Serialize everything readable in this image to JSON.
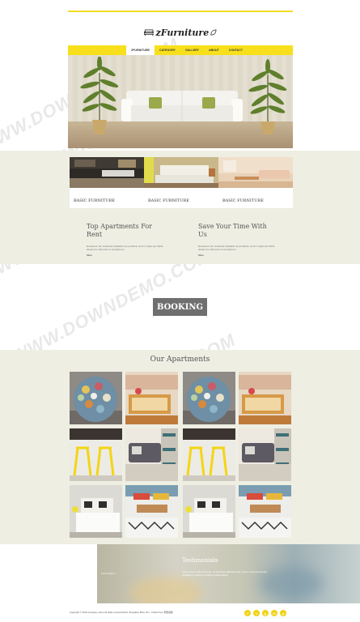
{
  "header": {
    "logo_text": "zFurniture",
    "nav": [
      "zfurniture",
      "category",
      "gallery",
      "about",
      "contact"
    ]
  },
  "features": [
    {
      "title": "BASIC FURNITURE"
    },
    {
      "title": "BASIC FURNITURE"
    },
    {
      "title": "BASIC FURNITURE"
    }
  ],
  "columns": [
    {
      "title": "Top Apartments For Rent",
      "text": "Excepteur sint occaecat cupidatat non proident, sunt in culpa qui officia deserunt mollit anim id est laborum.",
      "more": "More"
    },
    {
      "title": "Save Your Time With Us",
      "text": "Excepteur sint occaecat cupidatat non proident, sunt in culpa qui officia deserunt mollit anim id est laborum.",
      "more": "More"
    }
  ],
  "booking": {
    "label": "BOOKING"
  },
  "apartments": {
    "title": "Our Apartments"
  },
  "testimonials": {
    "title": "Testimonials",
    "left_label": "Lorem Ipsum",
    "text": "Lorem ipsum dolor sit amet, consectetur adipiscing elit, sed do eiusmod tempor incididunt ut labore et dolore magna aliqua."
  },
  "footer": {
    "copyright": "Copyright © 2014.Company name All rights reserved.More Templates More Info - Collect from 网页模板",
    "social": [
      "f",
      "t",
      "g",
      "in",
      "p"
    ]
  },
  "watermark": "WWW.DOWNDEMO.COM",
  "colors": {
    "accent": "#f7e01b",
    "band": "#eeeee3",
    "booking": "#6f6f6f"
  }
}
